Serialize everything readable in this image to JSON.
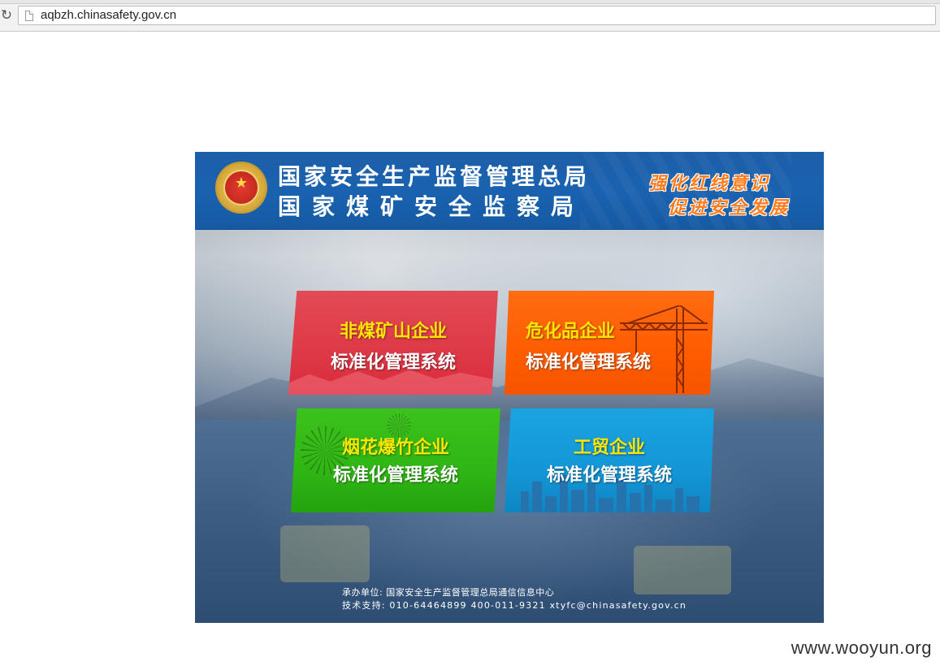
{
  "browser": {
    "url": "aqbzh.chinasafety.gov.cn",
    "reload_icon": "reload-icon",
    "page_icon": "page-icon"
  },
  "header": {
    "agency_line1": "国家安全生产监督管理总局",
    "agency_line2": "国家煤矿安全监察局",
    "slogan_line1": "强化红线意识",
    "slogan_line2": "促进安全发展",
    "emblem_icon": "national-emblem-icon"
  },
  "tiles": [
    {
      "title": "非煤矿山企业",
      "subtitle": "标准化管理系统",
      "color": "#de3846"
    },
    {
      "title": "危化品企业",
      "subtitle": "标准化管理系统",
      "color": "#ff5c00"
    },
    {
      "title": "烟花爆竹企业",
      "subtitle": "标准化管理系统",
      "color": "#2fb614"
    },
    {
      "title": "工贸企业",
      "subtitle": "标准化管理系统",
      "color": "#1496d6"
    }
  ],
  "footer": {
    "line1": "承办单位: 国家安全生产监督管理总局通信信息中心",
    "line2": "技术支持: 010-64464899   400-011-9321   xtyfc@chinasafety.gov.cn"
  },
  "watermark": "www.wooyun.org"
}
